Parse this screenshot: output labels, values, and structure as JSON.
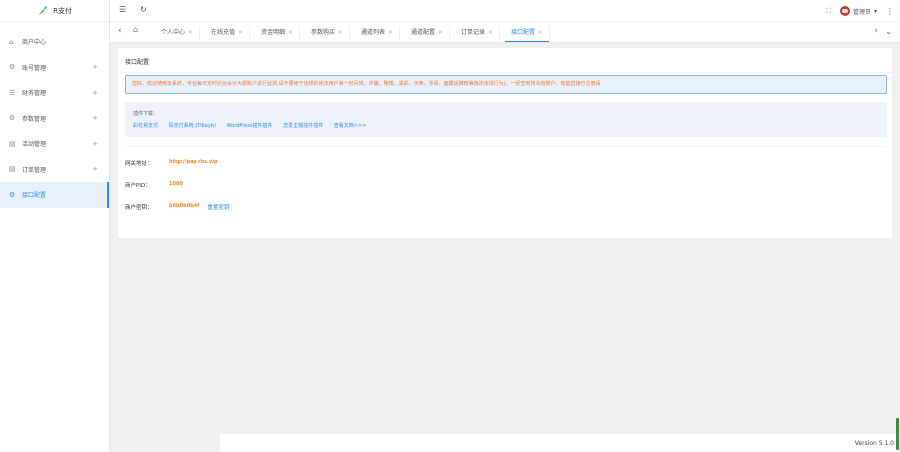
{
  "app": {
    "name": "R支付"
  },
  "sidebar": {
    "items": [
      {
        "label": "商户中心",
        "icon": "home-icon",
        "glyph": "⌂",
        "expandable": false,
        "active": false
      },
      {
        "label": "账号管理",
        "icon": "gear-icon",
        "glyph": "⚙",
        "expandable": true,
        "active": false
      },
      {
        "label": "财务管理",
        "icon": "list-icon",
        "glyph": "☰",
        "expandable": true,
        "active": false
      },
      {
        "label": "参数管理",
        "icon": "settings-icon",
        "glyph": "⚙",
        "expandable": true,
        "active": false
      },
      {
        "label": "活动管理",
        "icon": "chart-icon",
        "glyph": "▤",
        "expandable": true,
        "active": false
      },
      {
        "label": "订单管理",
        "icon": "chart-icon",
        "glyph": "▤",
        "expandable": true,
        "active": false
      },
      {
        "label": "接口配置",
        "icon": "settings-icon",
        "glyph": "⚙",
        "expandable": false,
        "active": true
      }
    ]
  },
  "header": {
    "menu_icon": "☰",
    "refresh_icon": "↻",
    "fullscreen_icon": "⛶",
    "user": "管理员",
    "dropdown_icon": "▾",
    "more_icon": "⋮"
  },
  "tabs": [
    {
      "label": "个人中心",
      "active": false
    },
    {
      "label": "在线充值",
      "active": false
    },
    {
      "label": "资金明细",
      "active": false
    },
    {
      "label": "参数购买",
      "active": false
    },
    {
      "label": "通道列表",
      "active": false
    },
    {
      "label": "通道配置",
      "active": false
    },
    {
      "label": "订单记录",
      "active": false
    },
    {
      "label": "接口配置",
      "active": true
    }
  ],
  "page": {
    "title": "接口配置",
    "alert": "您好，欢迎使用本系统，平台每日定时后台会对大额账户进行监测,请不要用于违规的违法用户第一时间将，诈骗，赌博，黑彩，涉黄，涉毒，面膜话推荐等违法违规行为)，一经查到将冻结账户，有能直接已注册请",
    "plugins_title": "插件下载：",
    "plugins": [
      "彩虹易支付",
      "码支付系统 (Tlbayb)",
      "WordPress插件插件",
      "恋爱主题插件插件",
      "查看文档>>>"
    ],
    "api_url_label": "网关地址：",
    "api_url": "http://pay.rbs.vip",
    "merchant_id_label": "商户PID：",
    "merchant_id": "1000",
    "merchant_key_label": "商户密钥：",
    "merchant_key": "b6b0b0b4f",
    "reset_key": "重置密钥"
  },
  "footer": {
    "version": "Version 5.1.0"
  }
}
